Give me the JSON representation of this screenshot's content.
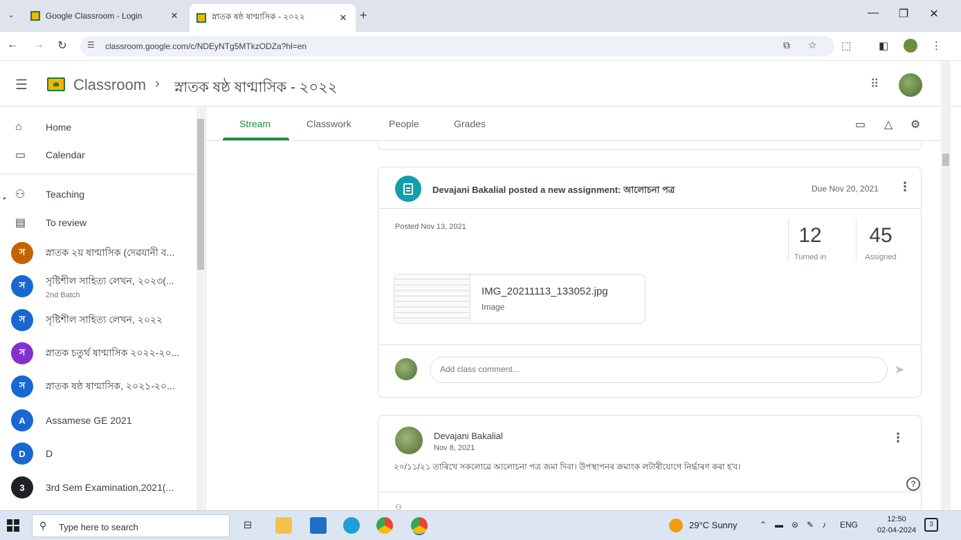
{
  "browser": {
    "tabs": [
      {
        "title": "Google Classroom - Login",
        "active": false
      },
      {
        "title": "স্নাতক ষষ্ঠ ষাণ্মাসিক - ২০২২",
        "active": true
      }
    ],
    "new_tab": "+",
    "window_controls": [
      "—",
      "❐",
      "✕"
    ],
    "url": "classroom.google.com/c/NDEyNTg5MTkzODZa?hl=en"
  },
  "header": {
    "brand": "Classroom",
    "separator": "›",
    "course": "স্নাতক ষষ্ঠ ষাণ্মাসিক - ২০২২"
  },
  "sidebar": {
    "nav": [
      {
        "label": "Home",
        "icon": "home-icon"
      },
      {
        "label": "Calendar",
        "icon": "calendar-icon"
      },
      {
        "label": "Teaching",
        "icon": "people-icon"
      },
      {
        "label": "To review",
        "icon": "review-icon"
      }
    ],
    "classes": [
      {
        "letter": "স",
        "label": "স্নাতক ২য় ষাণ্মাসিক (দেৱযানী ব...",
        "sub": "",
        "color": "#c26401"
      },
      {
        "letter": "স",
        "label": "সৃষ্টিশীল সাহিত্য লেখন, ২০২৩(...",
        "sub": "2nd Batch",
        "color": "#1967d2"
      },
      {
        "letter": "স",
        "label": "সৃষ্টিশীল সাহিত্য লেখন, ২০২২",
        "sub": "",
        "color": "#1967d2"
      },
      {
        "letter": "স",
        "label": "স্নাতক চতুৰ্থ ষাণ্মাসিক ২০২২-২০...",
        "sub": "",
        "color": "#8430ce"
      },
      {
        "letter": "স",
        "label": "স্নাতক ষষ্ঠ ষাণ্মাসিক, ২০২১-২০...",
        "sub": "",
        "color": "#1967d2"
      },
      {
        "letter": "A",
        "label": "Assamese GE 2021",
        "sub": "",
        "color": "#1967d2"
      },
      {
        "letter": "D",
        "label": "D",
        "sub": "",
        "color": "#1967d2"
      },
      {
        "letter": "3",
        "label": "3rd Sem Examination,2021(...",
        "sub": "",
        "color": "#202124"
      }
    ]
  },
  "course_tabs": [
    "Stream",
    "Classwork",
    "People",
    "Grades"
  ],
  "active_tab": "Stream",
  "assignment_card": {
    "title": "Devajani Bakalial posted a new assignment: আলোচনা পত্র",
    "due": "Due Nov 20, 2021",
    "posted": "Posted Nov 13, 2021",
    "turned_in": "12",
    "turned_in_label": "Turned in",
    "assigned": "45",
    "assigned_label": "Assigned",
    "attachment_name": "IMG_20211113_133052.jpg",
    "attachment_type": "Image",
    "comment_placeholder": "Add class comment..."
  },
  "announcement_card": {
    "author": "Devajani Bakalial",
    "date": "Nov 8, 2021",
    "text": "২০/১১/২১ তাৰিখে সকলোৱে আলোচনা পত্ৰ জমা দিবা। উপস্থাপনৰ ক্ৰমাংক লটাৰীযোগে নিৰ্দ্ধাৰণ কৰা হ'ব।"
  },
  "taskbar": {
    "search_placeholder": "Type here to search",
    "weather": "29°C  Sunny",
    "language": "ENG",
    "time": "12:50",
    "date": "02-04-2024",
    "notification_count": "3"
  }
}
